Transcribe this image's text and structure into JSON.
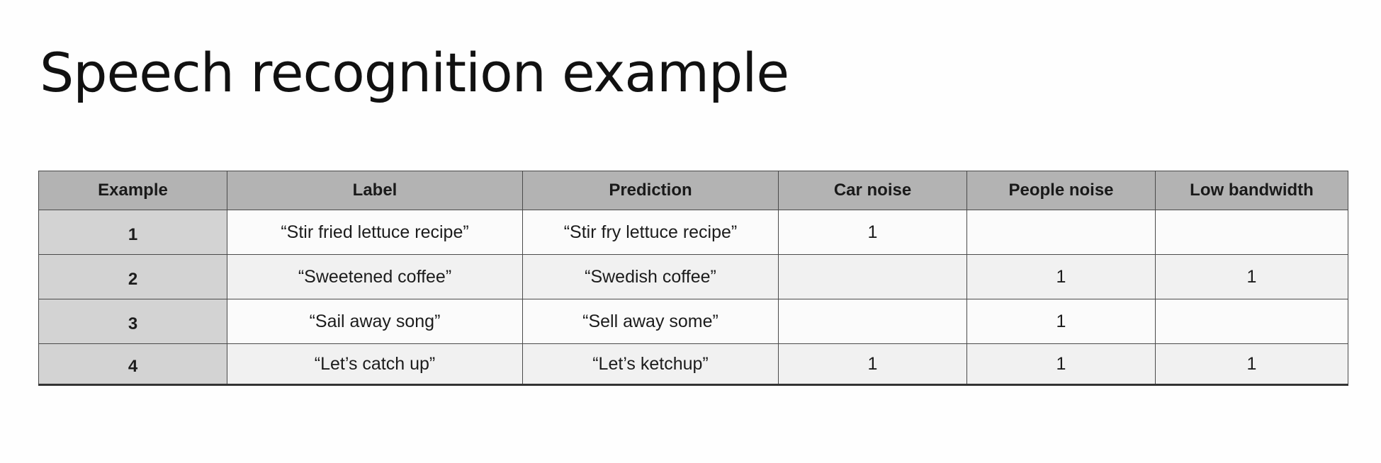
{
  "slide": {
    "title": "Speech recognition example"
  },
  "table": {
    "headers": [
      "Example",
      "Label",
      "Prediction",
      "Car noise",
      "People noise",
      "Low bandwidth"
    ],
    "rows": [
      {
        "example": "1",
        "label": "“Stir fried lettuce recipe”",
        "prediction": "“Stir fry lettuce recipe”",
        "car_noise": "1",
        "people_noise": "",
        "low_bandwidth": ""
      },
      {
        "example": "2",
        "label": "“Sweetened coffee”",
        "prediction": "“Swedish coffee”",
        "car_noise": "",
        "people_noise": "1",
        "low_bandwidth": "1"
      },
      {
        "example": "3",
        "label": "“Sail away song”",
        "prediction": "“Sell away some”",
        "car_noise": "",
        "people_noise": "1",
        "low_bandwidth": ""
      },
      {
        "example": "4",
        "label": "“Let’s catch up”",
        "prediction": "“Let’s ketchup”",
        "car_noise": "1",
        "people_noise": "1",
        "low_bandwidth": "1"
      }
    ]
  }
}
